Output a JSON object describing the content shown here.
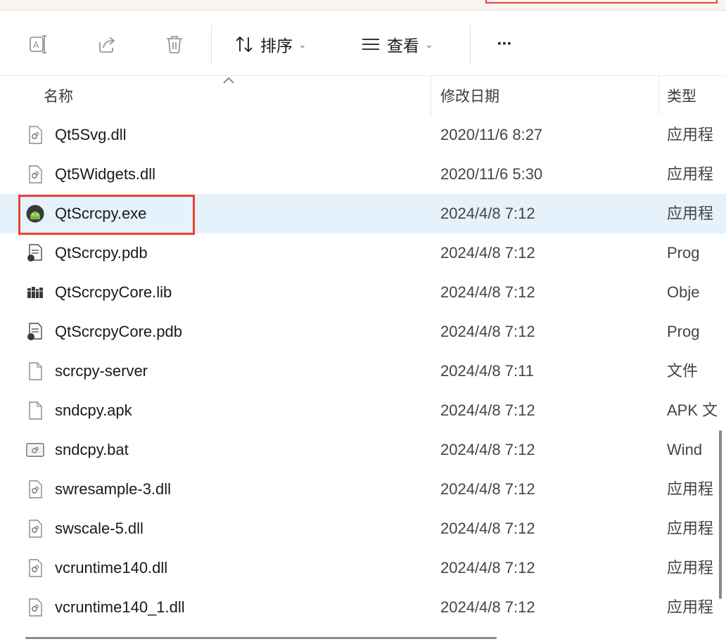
{
  "toolbar": {
    "rename_icon": "rename-icon",
    "share_icon": "share-icon",
    "delete_icon": "delete-icon",
    "sort_label": "排序",
    "view_label": "查看",
    "more_label": "···"
  },
  "columns": {
    "name": "名称",
    "modified": "修改日期",
    "type": "类型"
  },
  "files": [
    {
      "name": "Qt5Svg.dll",
      "date": "2020/11/6 8:27",
      "type": "应用程",
      "icon": "dll-file-icon"
    },
    {
      "name": "Qt5Widgets.dll",
      "date": "2020/11/6 5:30",
      "type": "应用程",
      "icon": "dll-file-icon"
    },
    {
      "name": "QtScrcpy.exe",
      "date": "2024/4/8 7:12",
      "type": "应用程",
      "icon": "android-app-icon",
      "selected": true
    },
    {
      "name": "QtScrcpy.pdb",
      "date": "2024/4/8 7:12",
      "type": "Prog",
      "icon": "pdb-file-icon"
    },
    {
      "name": "QtScrcpyCore.lib",
      "date": "2024/4/8 7:12",
      "type": "Obje",
      "icon": "lib-file-icon"
    },
    {
      "name": "QtScrcpyCore.pdb",
      "date": "2024/4/8 7:12",
      "type": "Prog",
      "icon": "pdb-file-icon"
    },
    {
      "name": "scrcpy-server",
      "date": "2024/4/8 7:11",
      "type": "文件",
      "icon": "blank-file-icon"
    },
    {
      "name": "sndcpy.apk",
      "date": "2024/4/8 7:12",
      "type": "APK 文",
      "icon": "blank-file-icon"
    },
    {
      "name": "sndcpy.bat",
      "date": "2024/4/8 7:12",
      "type": "Wind",
      "icon": "bat-file-icon"
    },
    {
      "name": "swresample-3.dll",
      "date": "2024/4/8 7:12",
      "type": "应用程",
      "icon": "dll-file-icon"
    },
    {
      "name": "swscale-5.dll",
      "date": "2024/4/8 7:12",
      "type": "应用程",
      "icon": "dll-file-icon"
    },
    {
      "name": "vcruntime140.dll",
      "date": "2024/4/8 7:12",
      "type": "应用程",
      "icon": "dll-file-icon"
    },
    {
      "name": "vcruntime140_1.dll",
      "date": "2024/4/8 7:12",
      "type": "应用程",
      "icon": "dll-file-icon"
    }
  ],
  "colors": {
    "selection": "#e5f1fb",
    "highlight_border": "#e8442f"
  }
}
